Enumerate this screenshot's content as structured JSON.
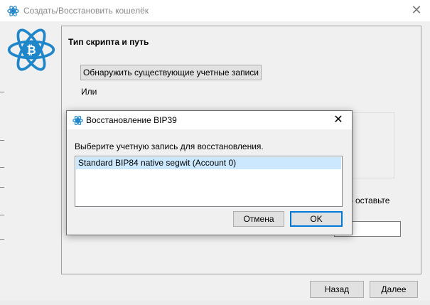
{
  "main_window": {
    "title": "Создать/Восстановить кошелёк",
    "close_symbol": "✕",
    "section_title": "Тип скрипта и путь",
    "discover_button": "Обнаружить существующие учетные записи",
    "or_label": "Или",
    "leave_hint": "– оставьте",
    "back_button": "Назад",
    "next_button": "Далее"
  },
  "dialog": {
    "title": "Восстановление BIP39",
    "close_symbol": "✕",
    "prompt": "Выберите учетную запись для восстановления.",
    "accounts": [
      "Standard BIP84 native segwit (Account 0)"
    ],
    "selected_index": 0,
    "cancel_button": "Отмена",
    "ok_button": "OK"
  },
  "icons": {
    "app": "electrum-bitcoin-atom-icon",
    "dialog": "electrum-bitcoin-atom-icon"
  },
  "colors": {
    "accent": "#0078d7",
    "logo": "#1f87c9",
    "selection": "#cce8ff"
  }
}
